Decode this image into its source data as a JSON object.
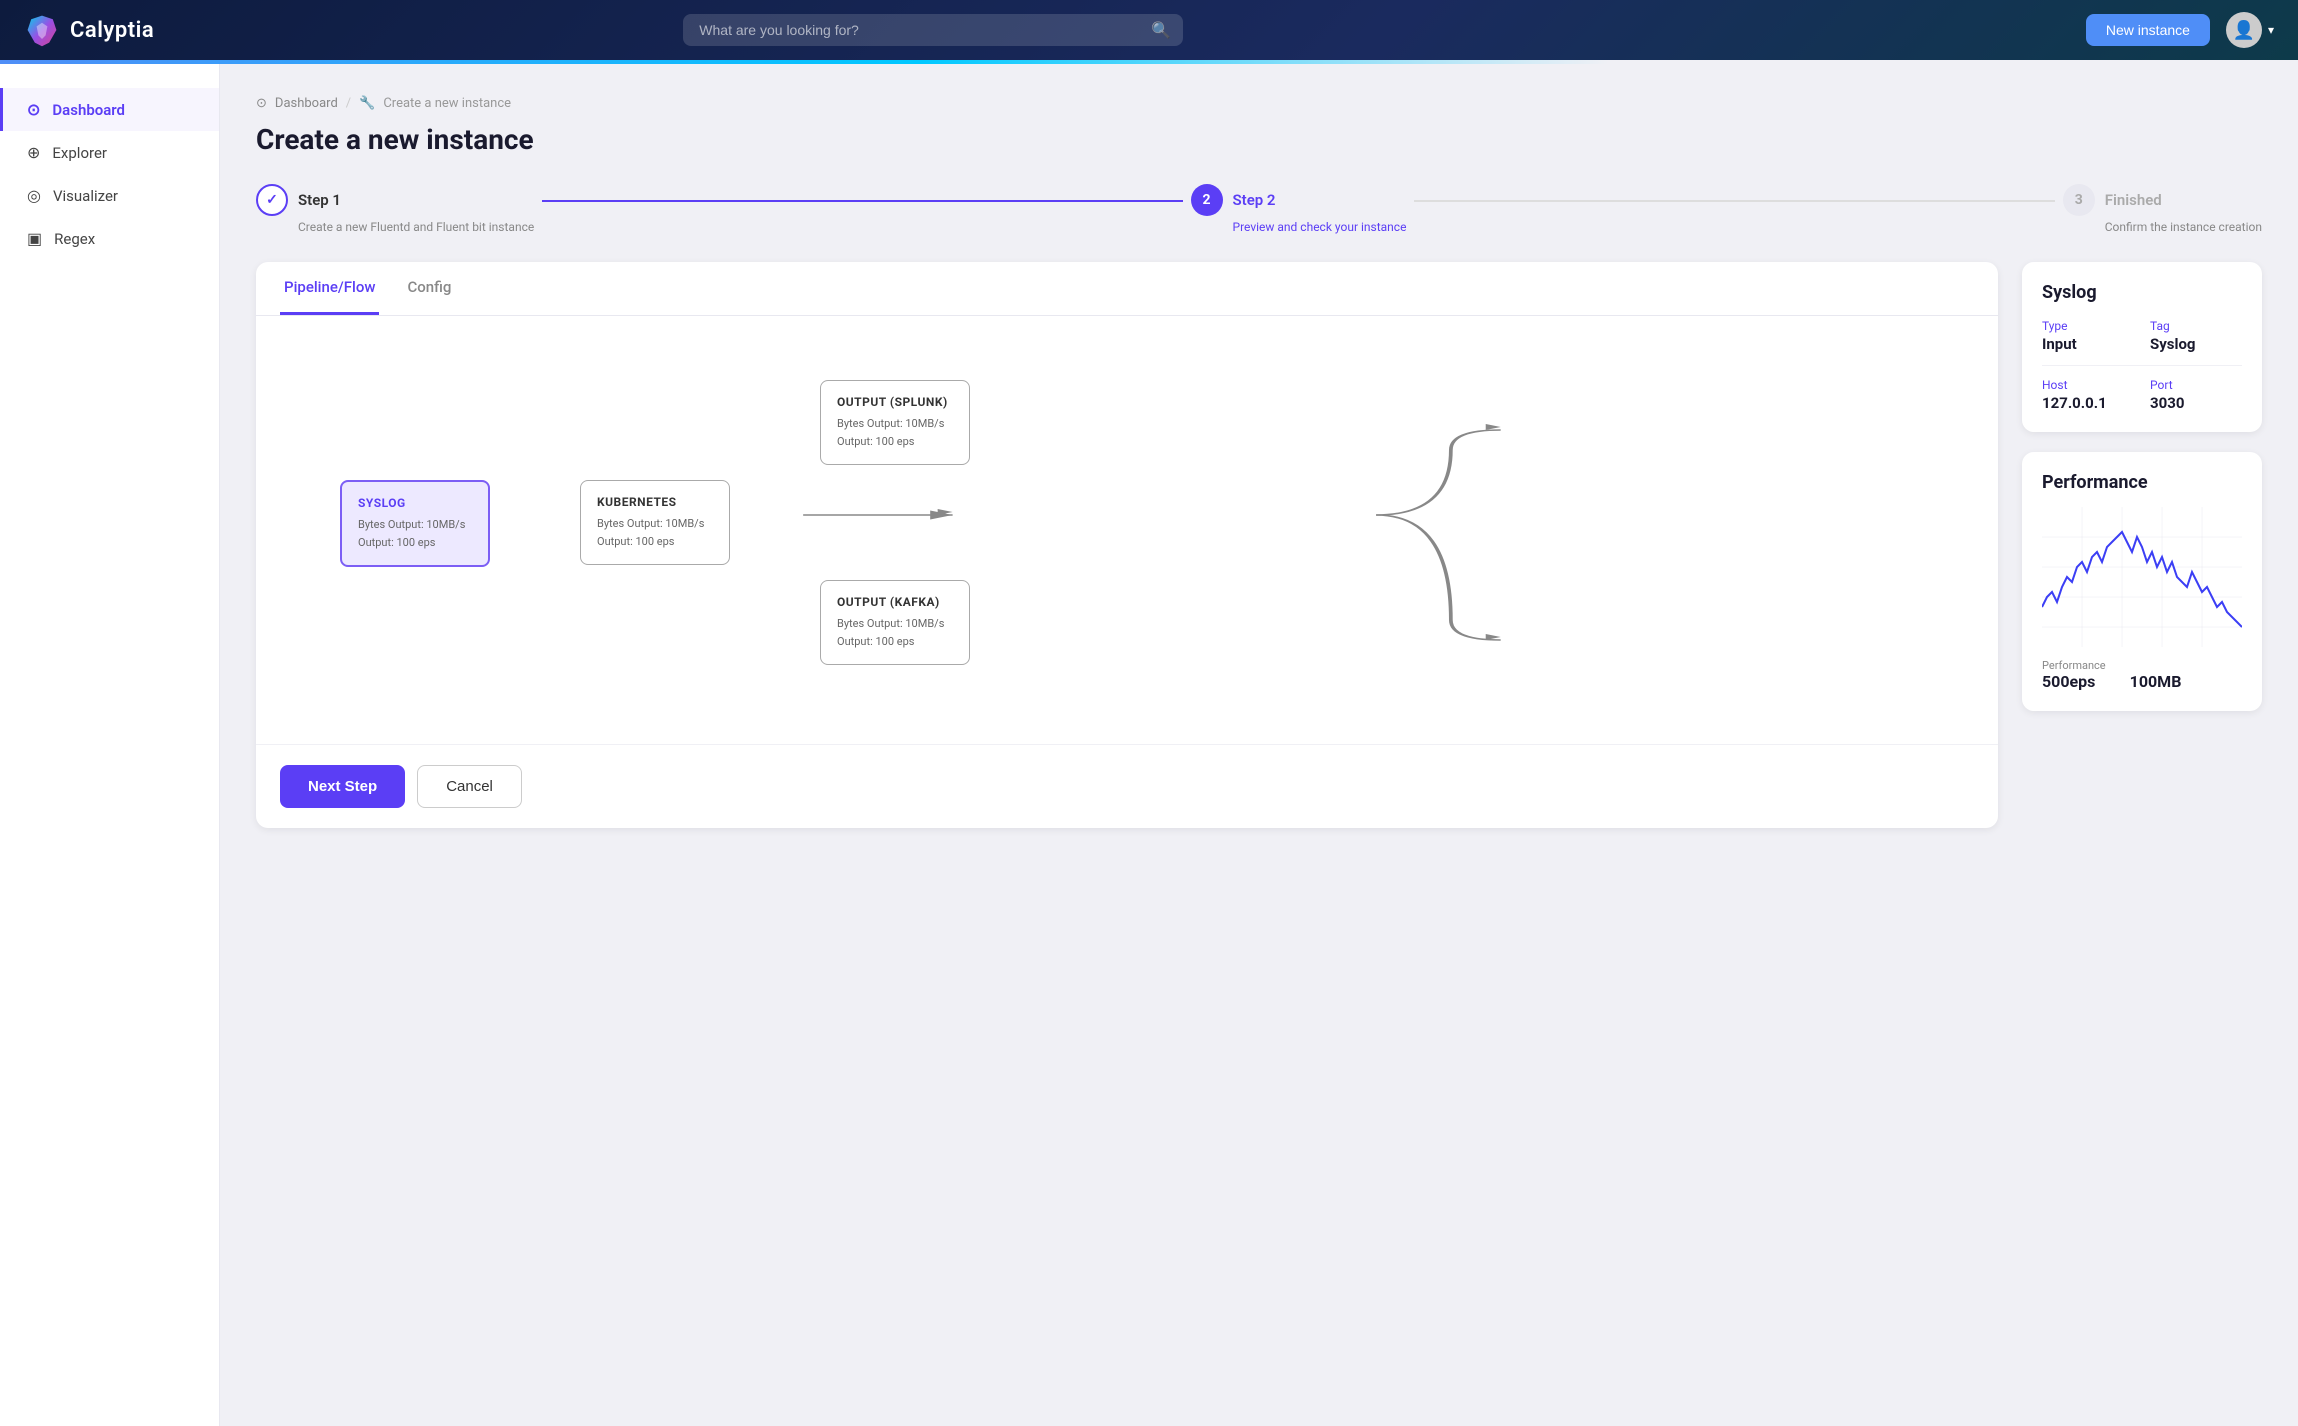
{
  "app": {
    "name": "Calyptia"
  },
  "topnav": {
    "search_placeholder": "What are you looking for?",
    "new_instance_label": "New instance"
  },
  "sidebar": {
    "items": [
      {
        "id": "dashboard",
        "label": "Dashboard",
        "icon": "⊙",
        "active": true
      },
      {
        "id": "explorer",
        "label": "Explorer",
        "icon": "⊕"
      },
      {
        "id": "visualizer",
        "label": "Visualizer",
        "icon": "◎"
      },
      {
        "id": "regex",
        "label": "Regex",
        "icon": "▣"
      }
    ]
  },
  "breadcrumb": {
    "parent": "Dashboard",
    "current": "Create a new instance",
    "separator": "/"
  },
  "page_title": "Create a new instance",
  "steps": [
    {
      "number": "✓",
      "label": "Step 1",
      "description": "Create a new Fluentd and Fluent bit instance",
      "state": "done"
    },
    {
      "number": "2",
      "label": "Step 2",
      "description": "Preview and check your instance",
      "state": "active"
    },
    {
      "number": "3",
      "label": "Finished",
      "description": "Confirm the instance creation",
      "state": "inactive"
    }
  ],
  "tabs": [
    {
      "id": "pipeline",
      "label": "Pipeline/Flow",
      "active": true
    },
    {
      "id": "config",
      "label": "Config",
      "active": false
    }
  ],
  "flow": {
    "nodes": {
      "syslog": {
        "title": "SYSLOG",
        "bytes_output": "Bytes Output: 10MB/s",
        "output_eps": "Output: 100 eps"
      },
      "kubernetes": {
        "title": "KUBERNETES",
        "bytes_output": "Bytes Output: 10MB/s",
        "output_eps": "Output: 100 eps"
      },
      "output_splunk": {
        "title": "OUTPUT (SPLUNK)",
        "bytes_output": "Bytes Output: 10MB/s",
        "output_eps": "Output: 100 eps"
      },
      "output_kafka": {
        "title": "OUTPUT (KAFKA)",
        "bytes_output": "Bytes Output: 10MB/s",
        "output_eps": "Output: 100 eps"
      }
    }
  },
  "footer": {
    "next_step": "Next Step",
    "cancel": "Cancel"
  },
  "syslog_panel": {
    "title": "Syslog",
    "type_label": "Type",
    "type_value": "Input",
    "tag_label": "Tag",
    "tag_value": "Syslog",
    "host_label": "Host",
    "host_value": "127.0.0.1",
    "port_label": "Port",
    "port_value": "3030"
  },
  "performance_panel": {
    "title": "Performance",
    "perf_label": "Performance",
    "eps_value": "500eps",
    "mb_value": "100MB"
  }
}
